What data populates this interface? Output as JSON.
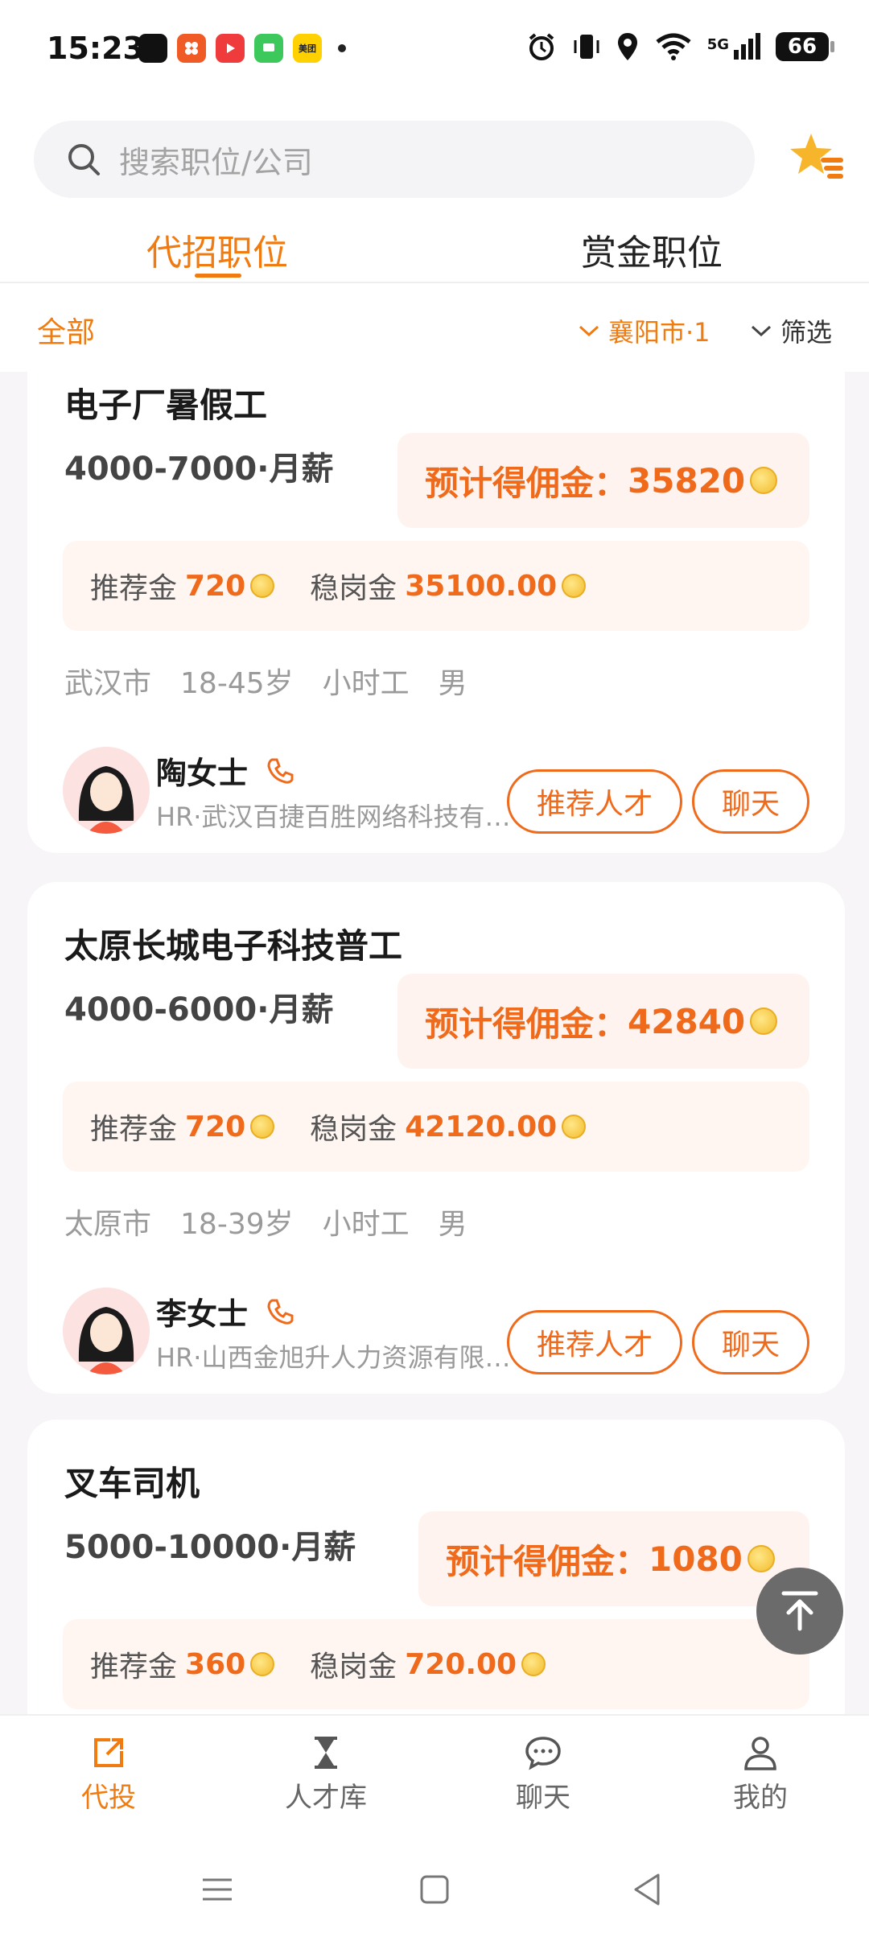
{
  "status_bar": {
    "time": "15:23",
    "battery": "66",
    "network": "5G",
    "icons": [
      "alarm-icon",
      "vibrate-icon",
      "location-icon",
      "wifi-icon",
      "signal-icon"
    ],
    "app_icons": [
      {
        "name": "app-icon-black",
        "color": "#111111",
        "text": ""
      },
      {
        "name": "app-icon-orange",
        "color": "#f05a24",
        "text": ""
      },
      {
        "name": "app-icon-red-video",
        "color": "#ef3b3b",
        "text": ""
      },
      {
        "name": "app-icon-green-chat",
        "color": "#3cc85a",
        "text": ""
      },
      {
        "name": "app-icon-meituan",
        "color": "#ffd100",
        "text": "美团"
      }
    ]
  },
  "search": {
    "placeholder": "搜索职位/公司"
  },
  "tabs": [
    {
      "label": "代招职位",
      "active": true
    },
    {
      "label": "赏金职位",
      "active": false
    }
  ],
  "filters": {
    "all": "全部",
    "city": "襄阳市·1",
    "screen": "筛选"
  },
  "jobs": [
    {
      "title": "电子厂暑假工",
      "salary": "4000-7000·月薪",
      "commission_label": "预计得佣金：",
      "commission_value": "35820",
      "referral_label": "推荐金",
      "referral_amount": "720",
      "retention_label": "稳岗金",
      "retention_amount": "35100.00",
      "tags": [
        "武汉市",
        "18-45岁",
        "小时工",
        "男"
      ],
      "hr_name": "陶女士",
      "hr_company": "HR·武汉百捷百胜网络科技有限公司",
      "recommend_btn": "推荐人才",
      "chat_btn": "聊天"
    },
    {
      "title": "太原长城电子科技普工",
      "salary": "4000-6000·月薪",
      "commission_label": "预计得佣金：",
      "commission_value": "42840",
      "referral_label": "推荐金",
      "referral_amount": "720",
      "retention_label": "稳岗金",
      "retention_amount": "42120.00",
      "tags": [
        "太原市",
        "18-39岁",
        "小时工",
        "男"
      ],
      "hr_name": "李女士",
      "hr_company": "HR·山西金旭升人力资源有限公司",
      "recommend_btn": "推荐人才",
      "chat_btn": "聊天"
    },
    {
      "title": "叉车司机",
      "salary": "5000-10000·月薪",
      "commission_label": "预计得佣金：",
      "commission_value": "1080",
      "referral_label": "推荐金",
      "referral_amount": "360",
      "retention_label": "稳岗金",
      "retention_amount": "720.00"
    }
  ],
  "bottom_nav": [
    {
      "label": "代投",
      "icon": "share-icon",
      "active": true
    },
    {
      "label": "人才库",
      "icon": "hourglass-icon",
      "active": false
    },
    {
      "label": "聊天",
      "icon": "chat-bubble-icon",
      "active": false
    },
    {
      "label": "我的",
      "icon": "user-icon",
      "active": false
    }
  ],
  "colors": {
    "accent": "#f07b10",
    "commission": "#f06a1c",
    "card_bg": "#ffffff",
    "list_bg": "#f7f5f8"
  }
}
